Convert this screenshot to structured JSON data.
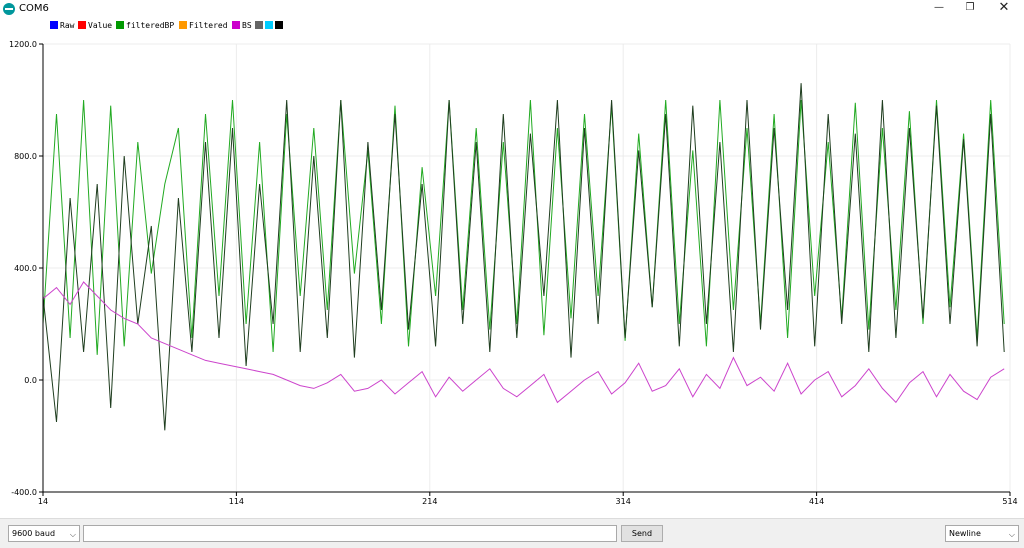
{
  "window": {
    "title": "COM6",
    "minimize_glyph": "—",
    "maximize_glyph": "❐",
    "close_glyph": "✕"
  },
  "colors": {
    "grid": "#ececec",
    "axis": "#000000",
    "plot_background": "#ffffff"
  },
  "chart_data": {
    "type": "line",
    "title": "",
    "xlabel": "",
    "ylabel": "",
    "xlim": [
      14,
      514
    ],
    "ylim": [
      -400,
      1200
    ],
    "x_ticks": [
      14,
      114,
      214,
      314,
      414,
      514
    ],
    "y_ticks": [
      -400,
      0,
      400,
      800,
      1200
    ],
    "x_tick_labels": [
      "14",
      "114",
      "214",
      "314",
      "414",
      "514"
    ],
    "y_tick_labels": [
      "-400.0",
      "0.0",
      "400.0",
      "800.0",
      "1200.0"
    ],
    "grid": true,
    "legend_position": "top-left",
    "legend": [
      {
        "name": "Raw",
        "color": "#0000ff"
      },
      {
        "name": "Value",
        "color": "#ff0000"
      },
      {
        "name": "filteredBP",
        "color": "#009900"
      },
      {
        "name": "Filtered",
        "color": "#ff9900"
      },
      {
        "name": "BS",
        "color": "#cc00cc"
      },
      {
        "name": "",
        "color": "#666666"
      },
      {
        "name": "",
        "color": "#00ccff"
      },
      {
        "name": "",
        "color": "#000000"
      }
    ],
    "x": [
      14,
      21,
      28,
      35,
      42,
      49,
      56,
      63,
      70,
      77,
      84,
      91,
      98,
      105,
      112,
      119,
      126,
      133,
      140,
      147,
      154,
      161,
      168,
      175,
      182,
      189,
      196,
      203,
      210,
      217,
      224,
      231,
      238,
      245,
      252,
      259,
      266,
      273,
      280,
      287,
      294,
      301,
      308,
      315,
      322,
      329,
      336,
      343,
      350,
      357,
      364,
      371,
      378,
      385,
      392,
      399,
      406,
      413,
      420,
      427,
      434,
      441,
      448,
      455,
      462,
      469,
      476,
      483,
      490,
      497,
      504,
      511
    ],
    "series": [
      {
        "name": "filteredBP",
        "color": "#22aa22",
        "values": [
          200,
          950,
          150,
          1000,
          90,
          980,
          120,
          850,
          380,
          700,
          900,
          150,
          950,
          300,
          1000,
          200,
          850,
          100,
          950,
          300,
          900,
          250,
          1000,
          380,
          820,
          200,
          980,
          120,
          760,
          300,
          1000,
          250,
          900,
          180,
          850,
          200,
          1000,
          160,
          900,
          220,
          950,
          300,
          980,
          140,
          880,
          260,
          1000,
          200,
          820,
          120,
          1000,
          250,
          900,
          200,
          950,
          150,
          1000,
          300,
          850,
          220,
          990,
          180,
          900,
          250,
          960,
          200,
          1000,
          260,
          880,
          150,
          1000,
          200
        ]
      },
      {
        "name": "",
        "color": "#1f3d1f",
        "values": [
          300,
          -150,
          650,
          100,
          700,
          -100,
          800,
          200,
          550,
          -180,
          650,
          100,
          850,
          150,
          900,
          50,
          700,
          200,
          1000,
          100,
          800,
          150,
          1000,
          80,
          850,
          250,
          950,
          180,
          700,
          120,
          1000,
          200,
          850,
          100,
          950,
          150,
          880,
          300,
          1000,
          80,
          900,
          200,
          1000,
          150,
          820,
          260,
          950,
          120,
          980,
          200,
          850,
          100,
          1000,
          180,
          900,
          250,
          1060,
          120,
          950,
          200,
          880,
          100,
          1000,
          150,
          900,
          220,
          980,
          200,
          860,
          120,
          950,
          100
        ]
      },
      {
        "name": "BS",
        "color": "#cc44cc",
        "values": [
          290,
          330,
          270,
          350,
          300,
          250,
          220,
          200,
          150,
          130,
          110,
          90,
          70,
          60,
          50,
          40,
          30,
          20,
          0,
          -20,
          -30,
          -10,
          20,
          -40,
          -30,
          0,
          -50,
          -10,
          30,
          -60,
          10,
          -40,
          0,
          40,
          -30,
          -60,
          -20,
          20,
          -80,
          -40,
          0,
          30,
          -50,
          -10,
          60,
          -40,
          -20,
          40,
          -60,
          20,
          -30,
          80,
          -20,
          10,
          -40,
          60,
          -50,
          0,
          30,
          -60,
          -20,
          40,
          -30,
          -80,
          -10,
          30,
          -60,
          20,
          -40,
          -70,
          10,
          40
        ]
      }
    ]
  },
  "controls": {
    "baud_select": "9600 baud",
    "send_input_value": "",
    "send_button": "Send",
    "line_ending_select": "Newline"
  }
}
